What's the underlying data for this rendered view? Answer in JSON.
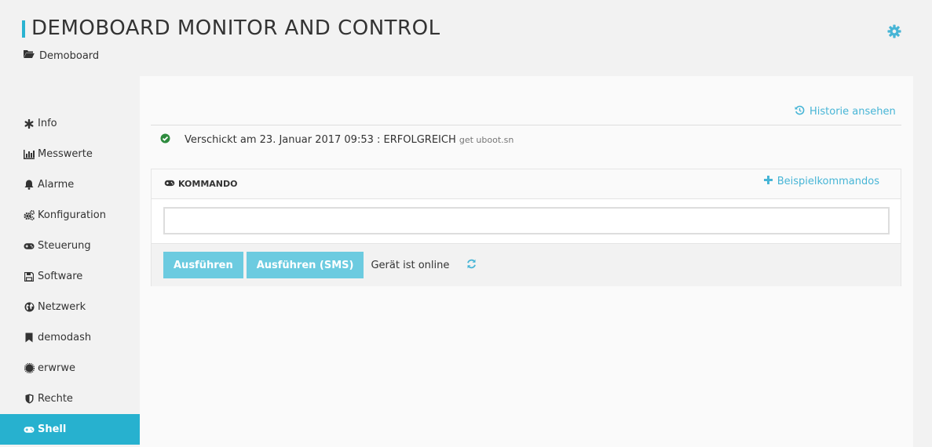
{
  "header": {
    "title": "DEMOBOARD MONITOR AND CONTROL",
    "breadcrumb": "Demoboard"
  },
  "sidebar": {
    "items": [
      {
        "label": "Info",
        "icon": "asterisk-icon"
      },
      {
        "label": "Messwerte",
        "icon": "bar-chart-icon"
      },
      {
        "label": "Alarme",
        "icon": "bell-icon"
      },
      {
        "label": "Konfiguration",
        "icon": "cogs-icon"
      },
      {
        "label": "Steuerung",
        "icon": "gamepad-icon"
      },
      {
        "label": "Software",
        "icon": "floppy-icon"
      },
      {
        "label": "Netzwerk",
        "icon": "globe-icon"
      },
      {
        "label": "demodash",
        "icon": "bookmark-icon"
      },
      {
        "label": "erwrwe",
        "icon": "certificate-icon"
      },
      {
        "label": "Rechte",
        "icon": "shield-icon"
      },
      {
        "label": "Shell",
        "icon": "gamepad-icon"
      }
    ],
    "active": "Shell"
  },
  "main": {
    "history_link": "Historie ansehen",
    "status_text": "Verschickt am 23. Januar 2017 09:53 : ERFOLGREICH",
    "status_command": "get uboot.sn",
    "command_box": {
      "heading": "KOMMANDO",
      "examples_link": "Beispielkommandos",
      "input_value": "",
      "execute_label": "Ausführen",
      "execute_sms_label": "Ausführen (SMS)",
      "device_status": "Gerät ist online"
    }
  },
  "colors": {
    "accent": "#27b1cf",
    "link": "#47b5d6",
    "button": "#6ccbe0",
    "success": "#2e8b3e"
  }
}
